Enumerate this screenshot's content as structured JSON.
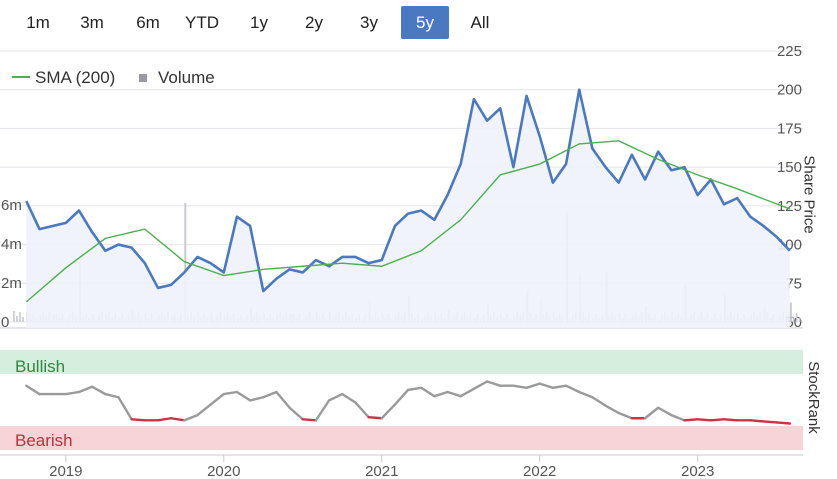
{
  "range_buttons": [
    {
      "label": "1m",
      "active": false
    },
    {
      "label": "3m",
      "active": false
    },
    {
      "label": "6m",
      "active": false
    },
    {
      "label": "YTD",
      "active": false
    },
    {
      "label": "1y",
      "active": false
    },
    {
      "label": "2y",
      "active": false
    },
    {
      "label": "3y",
      "active": false
    },
    {
      "label": "5y",
      "active": true
    },
    {
      "label": "All",
      "active": false
    }
  ],
  "colors": {
    "price": "#4a79c1",
    "sma": "#4caf50",
    "volume": "#c8c8d0",
    "stockrank_neutral": "#9a9a9a",
    "stockrank_bearish": "#cc3344",
    "bullish_band": "#d6eedd",
    "bearish_band": "#f6d4d8",
    "active_button": "#4a79c1"
  },
  "chart_data": [
    {
      "type": "line",
      "title": "",
      "legend": {
        "position": "top-left",
        "entries": [
          "SMA (200)",
          "Volume"
        ]
      },
      "y_right": {
        "label": "Share Price",
        "ticks": [
          "225",
          "200",
          "175",
          "150",
          "125",
          "100",
          "75",
          "50"
        ],
        "range": [
          50,
          225
        ]
      },
      "y_left_volume": {
        "ticks": [
          "6m",
          "4m",
          "2m",
          "0"
        ],
        "range": [
          0,
          7.5
        ]
      },
      "x_ticks": [
        "2019",
        "2020",
        "2021",
        "2022",
        "2023"
      ],
      "grid": true,
      "series": [
        {
          "name": "Price",
          "x": [
            "2018-10",
            "2018-11",
            "2018-12",
            "2019-01",
            "2019-02",
            "2019-03",
            "2019-04",
            "2019-05",
            "2019-06",
            "2019-07",
            "2019-08",
            "2019-09",
            "2019-10",
            "2019-11",
            "2019-12",
            "2020-01",
            "2020-02",
            "2020-03",
            "2020-04",
            "2020-05",
            "2020-06",
            "2020-07",
            "2020-08",
            "2020-09",
            "2020-10",
            "2020-11",
            "2020-12",
            "2021-01",
            "2021-02",
            "2021-03",
            "2021-04",
            "2021-05",
            "2021-06",
            "2021-07",
            "2021-08",
            "2021-09",
            "2021-10",
            "2021-11",
            "2021-12",
            "2022-01",
            "2022-02",
            "2022-03",
            "2022-04",
            "2022-05",
            "2022-06",
            "2022-07",
            "2022-08",
            "2022-09",
            "2022-10",
            "2022-11",
            "2022-12",
            "2023-01",
            "2023-02",
            "2023-03",
            "2023-04",
            "2023-05",
            "2023-06",
            "2023-07",
            "2023-08"
          ],
          "y": [
            128,
            110,
            112,
            114,
            122,
            108,
            96,
            100,
            98,
            88,
            72,
            74,
            82,
            92,
            88,
            82,
            118,
            112,
            70,
            78,
            84,
            82,
            90,
            86,
            92,
            92,
            88,
            90,
            112,
            120,
            122,
            116,
            132,
            152,
            194,
            180,
            188,
            150,
            196,
            170,
            140,
            152,
            200,
            162,
            150,
            140,
            158,
            142,
            160,
            148,
            150,
            132,
            142,
            126,
            130,
            118,
            112,
            105,
            96
          ]
        },
        {
          "name": "SMA (200)",
          "x": [
            "2018-10",
            "2019-01",
            "2019-04",
            "2019-07",
            "2019-10",
            "2020-01",
            "2020-04",
            "2020-07",
            "2020-10",
            "2021-01",
            "2021-04",
            "2021-07",
            "2021-10",
            "2022-01",
            "2022-04",
            "2022-07",
            "2022-10",
            "2023-01",
            "2023-04",
            "2023-08"
          ],
          "y": [
            63,
            85,
            104,
            110,
            89,
            80,
            84,
            86,
            88,
            86,
            96,
            116,
            145,
            152,
            165,
            167,
            155,
            145,
            136,
            123
          ]
        },
        {
          "name": "Volume",
          "x": [
            "2018-10",
            "2018-12",
            "2019-02",
            "2019-04",
            "2019-06",
            "2019-09",
            "2019-10",
            "2019-12",
            "2020-03",
            "2020-06",
            "2020-09",
            "2020-12",
            "2021-03",
            "2021-06",
            "2021-09",
            "2021-12",
            "2022-01",
            "2022-03",
            "2022-04",
            "2022-06",
            "2022-09",
            "2022-12",
            "2023-03",
            "2023-06",
            "2023-08"
          ],
          "y": [
            0.5,
            0.4,
            3.2,
            0.4,
            0.6,
            0.3,
            6.1,
            0.5,
            0.7,
            0.4,
            0.5,
            1.1,
            1.3,
            0.6,
            0.9,
            1.6,
            1.2,
            5.6,
            2.4,
            2.6,
            0.8,
            1.9,
            1.4,
            0.7,
            1.0
          ]
        }
      ]
    },
    {
      "type": "line",
      "title": "",
      "y_right": {
        "label": "StockRank"
      },
      "bands": [
        {
          "label": "Bullish"
        },
        {
          "label": "Bearish"
        }
      ],
      "series": [
        {
          "name": "StockRank",
          "x": [
            "2018-10",
            "2018-11",
            "2018-12",
            "2019-01",
            "2019-02",
            "2019-03",
            "2019-04",
            "2019-05",
            "2019-06",
            "2019-07",
            "2019-08",
            "2019-09",
            "2019-10",
            "2019-11",
            "2019-12",
            "2020-01",
            "2020-02",
            "2020-03",
            "2020-04",
            "2020-05",
            "2020-06",
            "2020-07",
            "2020-08",
            "2020-09",
            "2020-10",
            "2020-11",
            "2020-12",
            "2021-01",
            "2021-02",
            "2021-03",
            "2021-04",
            "2021-05",
            "2021-06",
            "2021-07",
            "2021-08",
            "2021-09",
            "2021-10",
            "2021-11",
            "2021-12",
            "2022-01",
            "2022-02",
            "2022-03",
            "2022-04",
            "2022-05",
            "2022-06",
            "2022-07",
            "2022-08",
            "2022-09",
            "2022-10",
            "2022-11",
            "2022-12",
            "2023-01",
            "2023-02",
            "2023-03",
            "2023-04",
            "2023-05",
            "2023-06",
            "2023-07",
            "2023-08"
          ],
          "y": [
            66,
            58,
            58,
            58,
            60,
            65,
            58,
            55,
            34,
            33,
            33,
            35,
            33,
            38,
            48,
            58,
            60,
            52,
            55,
            60,
            45,
            34,
            33,
            52,
            58,
            50,
            36,
            35,
            48,
            62,
            64,
            56,
            60,
            56,
            63,
            70,
            66,
            66,
            64,
            68,
            64,
            66,
            60,
            55,
            47,
            40,
            35,
            35,
            45,
            38,
            33,
            34,
            33,
            34,
            33,
            33,
            32,
            31,
            30
          ]
        }
      ]
    }
  ]
}
